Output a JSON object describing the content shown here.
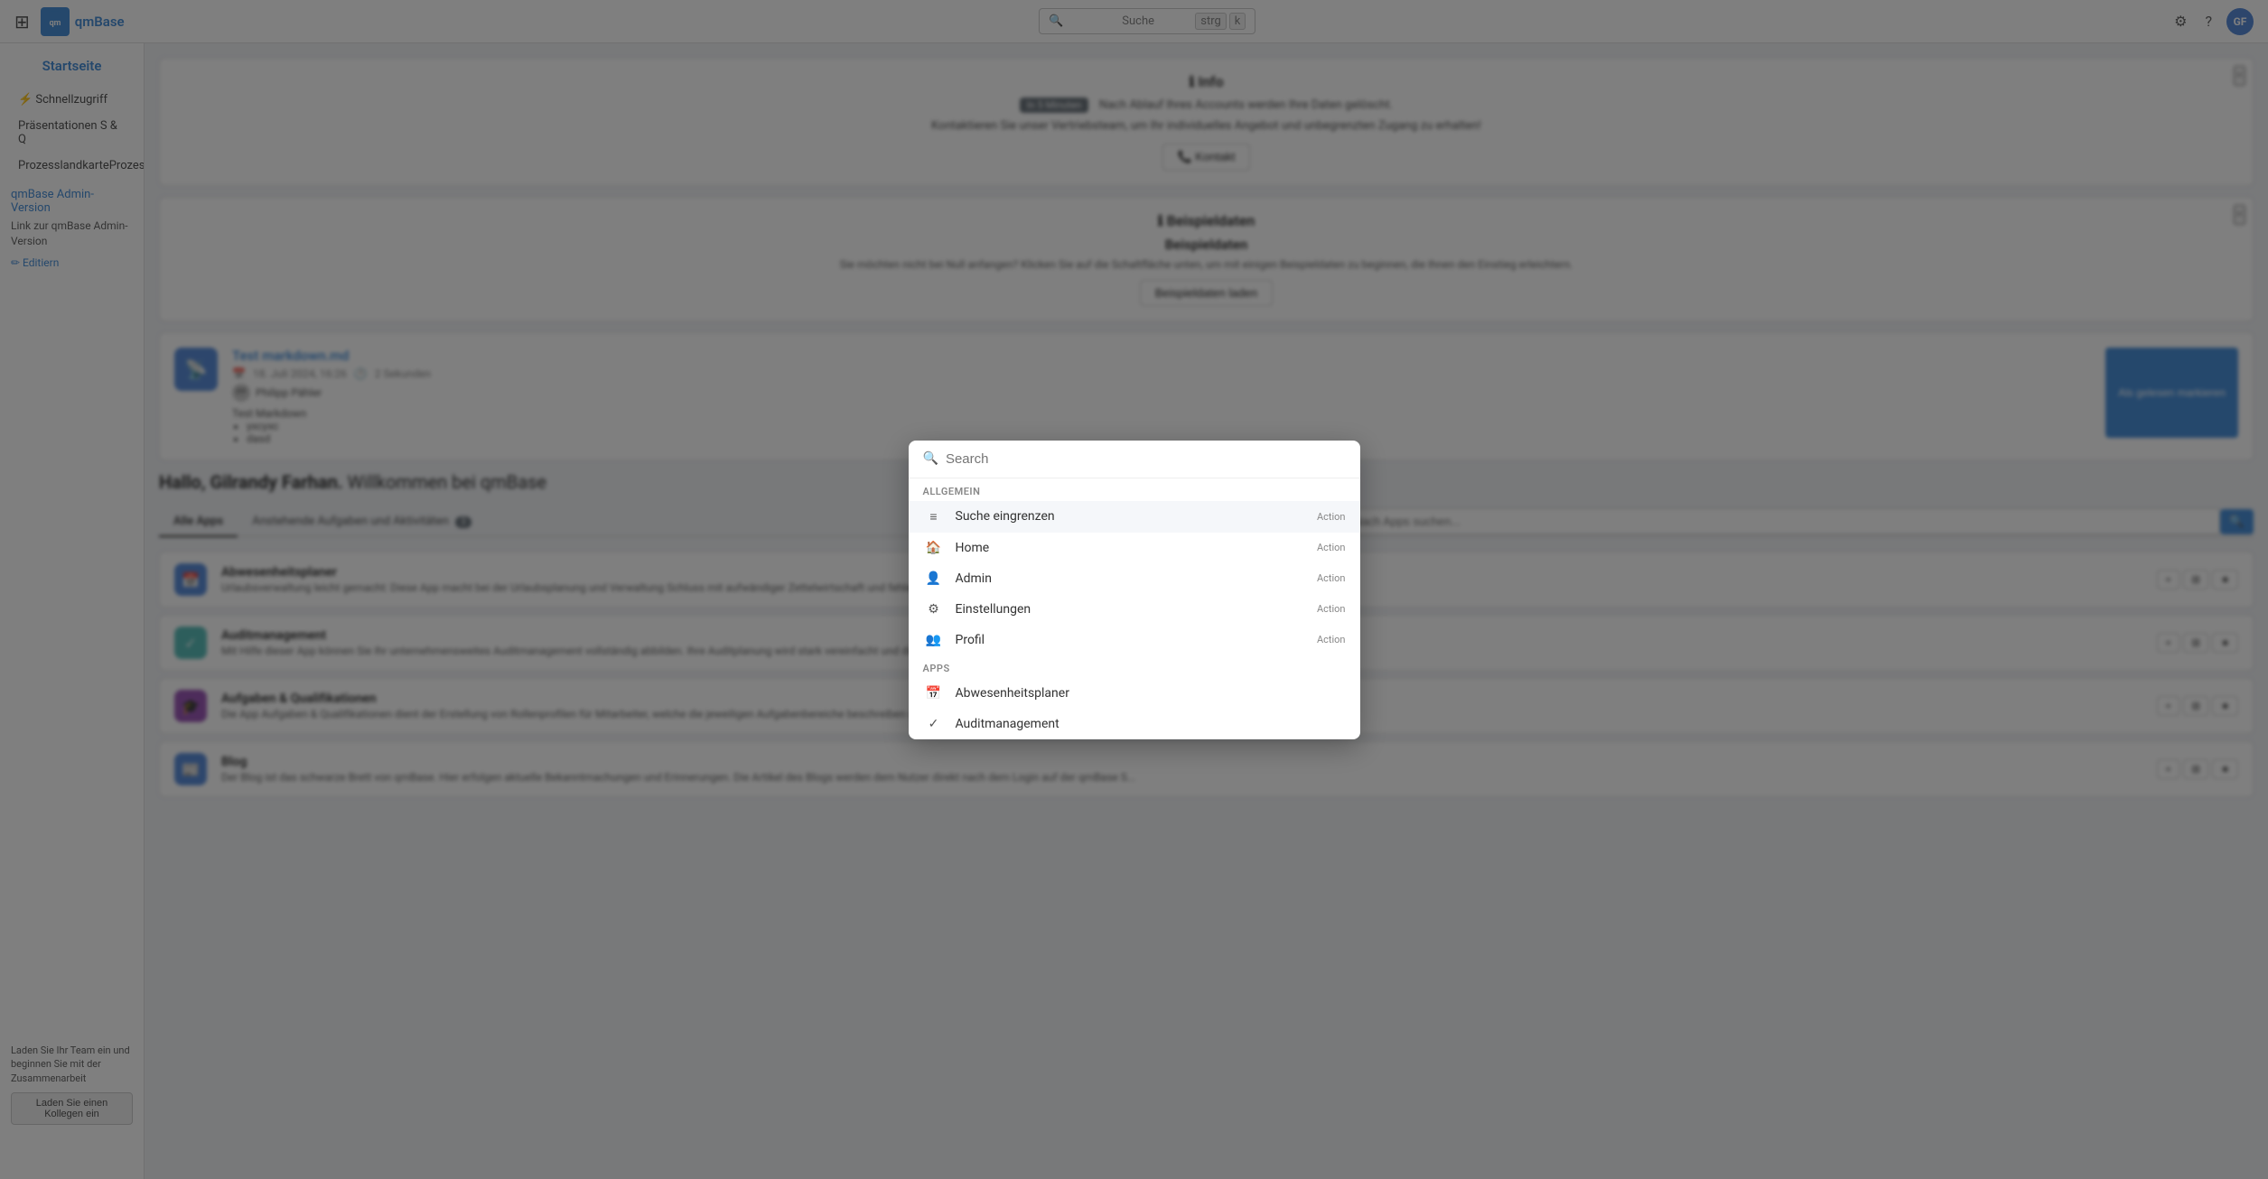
{
  "navbar": {
    "brand_name": "qmBase",
    "brand_abbr": "qm",
    "search_placeholder": "Suche",
    "kbd1": "strg",
    "kbd2": "k",
    "settings_icon": "⚙",
    "help_icon": "?",
    "avatar_initials": "GF"
  },
  "sidebar": {
    "title": "Startseite",
    "items": [
      {
        "label": "⚡ Schnellzugriff"
      },
      {
        "label": "Präsentationen S & Q"
      },
      {
        "label": "ProzesslandkarteProzesslantkarte..."
      }
    ],
    "admin_label": "qmBase Admin-Version",
    "admin_link_text": "Link zur qmBase Admin-Version",
    "edit_label": "✏ Editiern",
    "bottom_text": "Laden Sie Ihr Team ein und beginnen Sie mit der Zusammenarbeit",
    "bottom_btn": "Laden Sie einen Kollegen ein"
  },
  "info_banner": {
    "title": "ℹ Info",
    "badge": "In 5 Minuten",
    "text": "Nach Ablauf Ihres Accounts werden Ihre Daten gelöscht.",
    "contact_text": "Kontaktieren Sie unser Vertriebsteam, um Ihr individuelles Angebot und unbegrenzten Zugang zu erhalten!",
    "contact_btn": "📞 Kontakt"
  },
  "sample_banner": {
    "title": "ℹ Beispieldaten",
    "subtitle": "Beispieldaten",
    "text": "Sie möchten nicht bei Null anfangen? Klicken Sie auf die Schaltfläche unten, um mit einigen Beispieldaten zu beginnen, die Ihnen den Einstieg erleichtern.",
    "btn_label": "Beispieldaten laden"
  },
  "blog_post": {
    "title": "Test markdown.md",
    "date": "18. Juli 2024, 16:26",
    "duration": "2 Sekunden",
    "author": "Philipp Pähler",
    "preview_title": "Test Markdown",
    "items": [
      "yxcyxc",
      "dasd"
    ],
    "mark_read_btn": "Als gelesen markieren"
  },
  "welcome": {
    "greeting": "Hallo, Gilrandy Farhan.",
    "sub": "Willkommen bei qmBase"
  },
  "tabs": {
    "all_apps": "Alle Apps",
    "upcoming": "Anstehende Aufgaben und Aktivitäten",
    "upcoming_count": "3",
    "search_placeholder": "Nach Apps suchen..."
  },
  "apps": [
    {
      "name": "Abwesenheitsplaner",
      "icon": "📅",
      "icon_bg": "blue",
      "desc": "Urlaubsverwaltung leicht gemacht: Diese App macht bei der Urlaubsplanung und Verwaltung Schluss mit aufwändiger Zettelwirtschaft und fehleranfälligen Excel-Listen. Ihre Mitarbeiter..."
    },
    {
      "name": "Auditmanagement",
      "icon": "✓",
      "icon_bg": "teal",
      "desc": "Mit Hilfe dieser App können Sie Ihr unternehmensweites Auditmanagement vollständig abbilden. Ihre Auditplanung wird stark vereinfacht und die Durchführung Ihrer internen und extern..."
    },
    {
      "name": "Aufgaben & Qualifikationen",
      "icon": "🎓",
      "icon_bg": "purple",
      "desc": "Die App Aufgaben & Qualifikationen dient der Erstellung von Rollenprofilen für Mitarbeiter, welche die jeweiligen Aufgabenbereiche beschreiben und erforderliche Qualifikationen ent..."
    },
    {
      "name": "Blog",
      "icon": "📰",
      "icon_bg": "rss",
      "desc": "Der Blog ist das schwarze Brett von qmBase. Hier erfolgen aktuelle Bekanntmachungen und Erinnerungen. Die Artikel des Blogs werden dem Nutzer direkt nach dem Login auf der qmBase S..."
    }
  ],
  "search_modal": {
    "placeholder": "Search",
    "section_general": "Allgemein",
    "section_apps": "Apps",
    "items_general": [
      {
        "icon": "≡",
        "label": "Suche eingrenzen",
        "action": "Action",
        "highlighted": true
      },
      {
        "icon": "🏠",
        "label": "Home",
        "action": "Action"
      },
      {
        "icon": "👤",
        "label": "Admin",
        "action": "Action"
      },
      {
        "icon": "⚙",
        "label": "Einstellungen",
        "action": "Action"
      },
      {
        "icon": "👥",
        "label": "Profil",
        "action": "Action"
      }
    ],
    "items_apps": [
      {
        "icon": "📅",
        "label": "Abwesenheitsplaner"
      },
      {
        "icon": "✓",
        "label": "Auditmanagement"
      }
    ]
  }
}
